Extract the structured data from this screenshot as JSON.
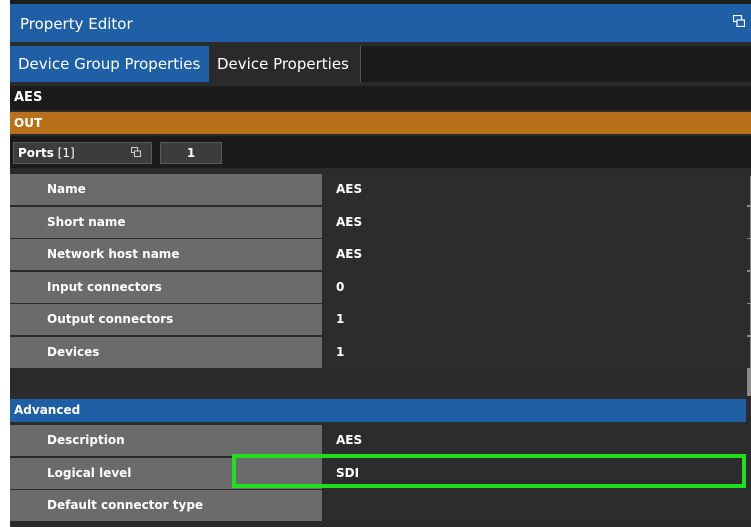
{
  "window": {
    "title": "Property Editor",
    "undock_icon": "undock-icon"
  },
  "tabs": [
    {
      "label": "Device Group Properties",
      "active": true
    },
    {
      "label": "Device Properties",
      "active": false
    }
  ],
  "group_name": "AES",
  "section_out": "OUT",
  "ports": {
    "label": "Ports",
    "count_text": "[1]",
    "value": "1"
  },
  "properties": [
    {
      "name": "Name",
      "value": "AES"
    },
    {
      "name": "Short name",
      "value": "AES"
    },
    {
      "name": "Network host name",
      "value": "AES"
    },
    {
      "name": "Input connectors",
      "value": "0"
    },
    {
      "name": "Output connectors",
      "value": "1"
    },
    {
      "name": "Devices",
      "value": "1"
    }
  ],
  "advanced_label": "Advanced",
  "advanced_properties": [
    {
      "name": "Description",
      "value": "AES"
    },
    {
      "name": "Logical level",
      "value": "SDI"
    },
    {
      "name": "Default connector type",
      "value": ""
    }
  ],
  "colors": {
    "accent_blue": "#1f5fa6",
    "out_orange": "#b8711a",
    "highlight_green": "#1fe01f"
  }
}
